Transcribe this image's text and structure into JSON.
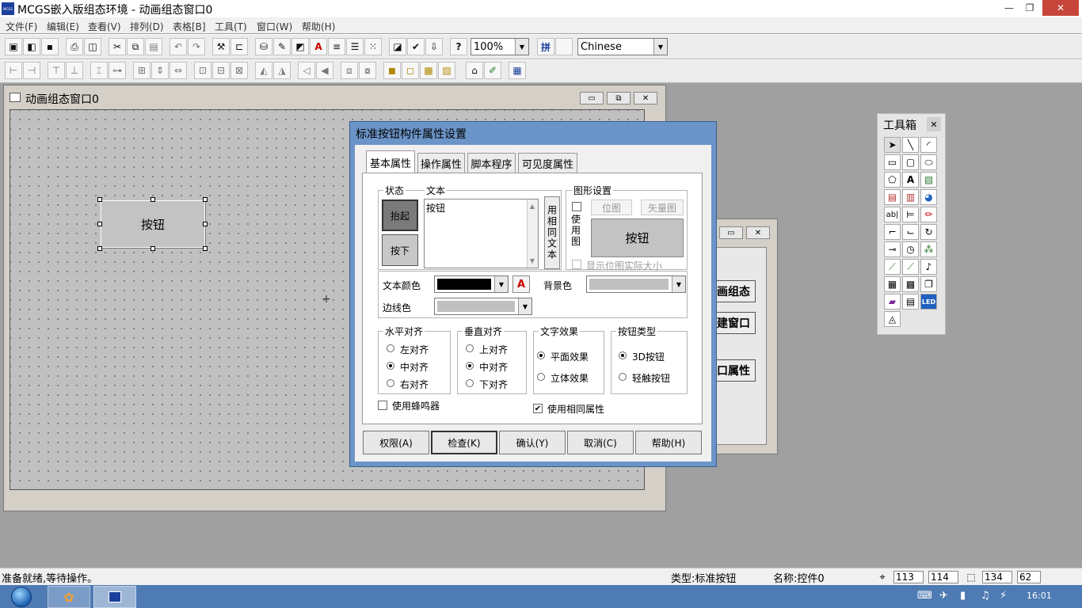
{
  "app": {
    "title": "MCGS嵌入版组态环境 - 动画组态窗口0",
    "icon_label": "MCGS"
  },
  "window_controls": {
    "minimize": "—",
    "restore": "❐",
    "close": "✕"
  },
  "menu": [
    "文件(F)",
    "编辑(E)",
    "查看(V)",
    "排列(D)",
    "表格[B]",
    "工具(T)",
    "窗口(W)",
    "帮助(H)"
  ],
  "toolbar1": {
    "zoom": "100%",
    "language": "Chinese"
  },
  "anim_window": {
    "title": "动画组态窗口0",
    "button_label": "按钮"
  },
  "bg_window": {
    "buttons": [
      "画组态",
      "建窗口",
      "口属性"
    ]
  },
  "toolbox": {
    "title": "工具箱",
    "close": "✕"
  },
  "dialog": {
    "title": "标准按钮构件属性设置",
    "tabs": [
      "基本属性",
      "操作属性",
      "脚本程序",
      "可见度属性"
    ],
    "state_group": "状态",
    "state_up": "抬起",
    "state_down": "按下",
    "text_group": "文本",
    "text_value": "按钮",
    "same_text": "用相同文本",
    "graphics_group": "图形设置",
    "use_graphic": "使用图",
    "bitmap": "位图",
    "vector": "矢量图",
    "preview_label": "按钮",
    "show_actual_size": "显示位图实际大小",
    "text_color_label": "文本颜色",
    "bg_color_label": "背景色",
    "border_color_label": "边线色",
    "halign_group": "水平对齐",
    "halign": [
      "左对齐",
      "中对齐",
      "右对齐"
    ],
    "valign_group": "垂直对齐",
    "valign": [
      "上对齐",
      "中对齐",
      "下对齐"
    ],
    "effect_group": "文字效果",
    "effects": [
      "平面效果",
      "立体效果"
    ],
    "type_group": "按钮类型",
    "types": [
      "3D按钮",
      "轻触按钮"
    ],
    "use_buzzer": "使用蜂鸣器",
    "use_same_props": "使用相同属性",
    "buttons": [
      "权限(A)",
      "检查(K)",
      "确认(Y)",
      "取消(C)",
      "帮助(H)"
    ],
    "colors": {
      "text": "#000000",
      "bg": "#c0c0c0",
      "border": "#c0c0c0"
    }
  },
  "status": {
    "message": "准备就绪,等待操作。",
    "type": "类型:标准按钮",
    "name": "名称:控件0",
    "x": "113",
    "y": "114",
    "w": "134",
    "h": "62"
  },
  "taskbar": {
    "time": "16:01"
  }
}
